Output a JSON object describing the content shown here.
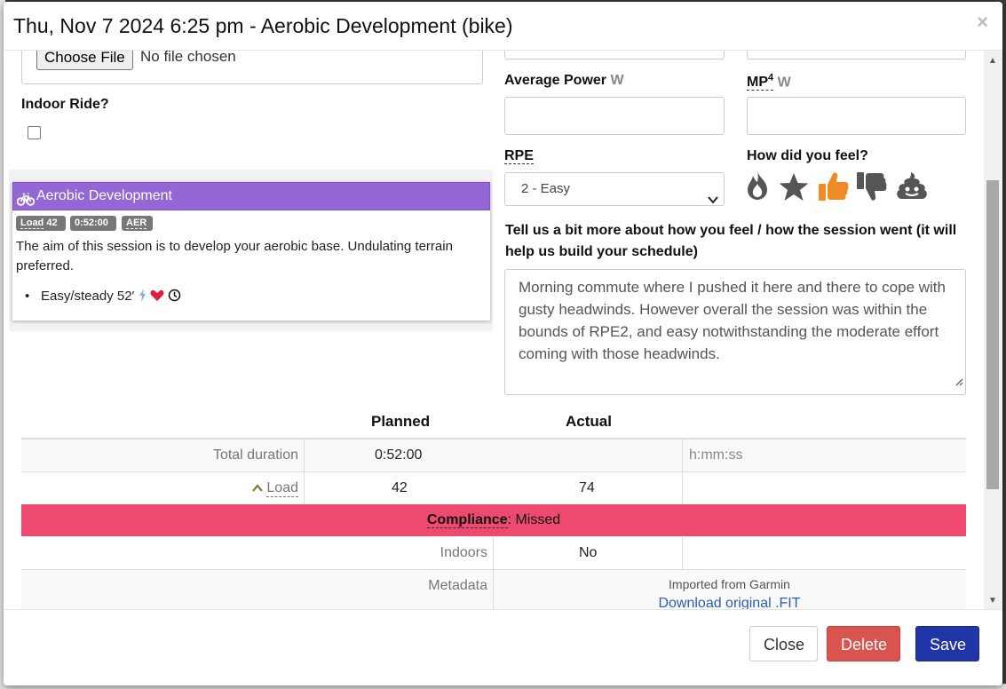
{
  "modal": {
    "title": "Thu, Nov 7 2024 6:25 pm - Aerobic Development (bike)",
    "close_glyph": "×"
  },
  "upload": {
    "button_label": "Choose File",
    "status": "No file chosen"
  },
  "indoor": {
    "label": "Indoor Ride?",
    "checked": false
  },
  "power": {
    "avg_label": "Average Power",
    "avg_unit": "W",
    "mp_label": "MP",
    "mp_sup": "4",
    "mp_unit": "W",
    "avg_value": "",
    "mp_value": ""
  },
  "rpe": {
    "label": "RPE",
    "selected": "2 - Easy"
  },
  "feel": {
    "label": "How did you feel?",
    "icons": [
      "fire-icon",
      "star-icon",
      "thumbs-up-icon",
      "thumbs-down-icon",
      "poop-icon"
    ],
    "selected": "thumbs-up-icon",
    "accent": "#f08a24",
    "default_color": "#555555"
  },
  "notes": {
    "question": "Tell us a bit more about how you feel / how the session went (it will help us build your schedule)",
    "text": "Morning commute where I pushed it here and there to cope with gusty headwinds. However overall the session was within the bounds of RPE2, and easy notwithstanding the moderate effort coming with those headwinds."
  },
  "workout": {
    "title": "Aerobic Development",
    "color": "#9466d6",
    "badges": [
      {
        "label": "Load",
        "value": "42"
      },
      {
        "label": "0:52:00"
      },
      {
        "label": "AER"
      }
    ],
    "description": "The aim of this session is to develop your aerobic base. Undulating terrain preferred.",
    "steps": [
      "Easy/steady 52′"
    ]
  },
  "summary": {
    "col_planned": "Planned",
    "col_actual": "Actual",
    "rows": [
      {
        "label": "Total duration",
        "planned": "0:52:00",
        "actual": "",
        "hint": "h:mm:ss"
      },
      {
        "label": "Load",
        "planned": "42",
        "actual": "74",
        "hint": ""
      }
    ],
    "compliance_label": "Compliance",
    "compliance_value": ": Missed",
    "compliance_color": "#ee4a6f",
    "indoors_label": "Indoors",
    "indoors_value": "No",
    "metadata_label": "Metadata",
    "metadata_source": "Imported from Garmin",
    "metadata_link": "Download original .FIT"
  },
  "footer": {
    "close_label": "Close",
    "delete_label": "Delete",
    "save_label": "Save"
  }
}
